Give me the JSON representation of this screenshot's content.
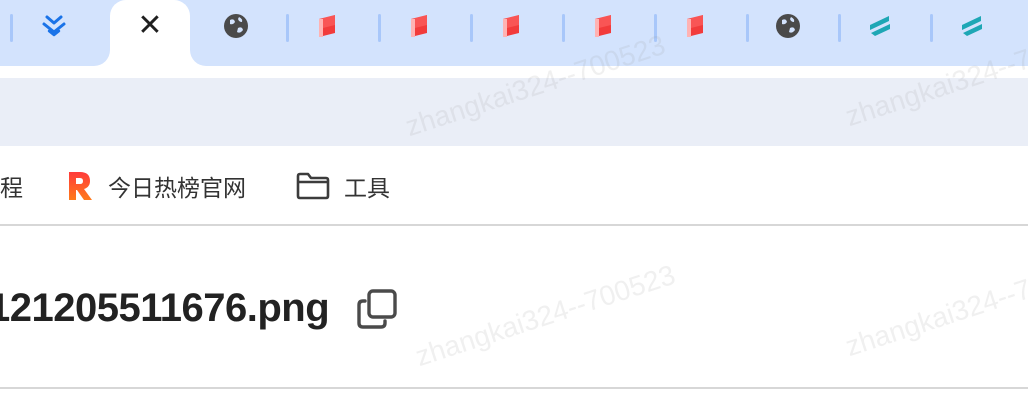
{
  "tabs": [
    {
      "icon": "layers-icon"
    },
    {
      "icon": "close-icon",
      "active": true,
      "close_glyph": "✕"
    },
    {
      "icon": "globe-icon"
    },
    {
      "icon": "red-flag-icon"
    },
    {
      "icon": "red-flag-icon"
    },
    {
      "icon": "red-flag-icon"
    },
    {
      "icon": "red-flag-icon"
    },
    {
      "icon": "red-flag-icon"
    },
    {
      "icon": "globe-icon"
    },
    {
      "icon": "teal-stripes-icon"
    },
    {
      "icon": "teal-stripes-icon"
    }
  ],
  "bookmarks": {
    "partial_label": "程",
    "items": [
      {
        "label": "今日热榜官网",
        "icon": "rebang-logo-icon"
      },
      {
        "label": "工具",
        "icon": "folder-icon"
      }
    ]
  },
  "content": {
    "filename": "121205511676.png"
  },
  "watermark": {
    "text": "zhangkai324--700523"
  },
  "colors": {
    "tabstrip_bg": "#d3e3fd",
    "omnibox_bg": "#eaeef7",
    "tab_separator": "#a8c7fa",
    "flag_red": "#f23b3b",
    "teal": "#1ea7b5",
    "blue": "#1a73e8"
  }
}
